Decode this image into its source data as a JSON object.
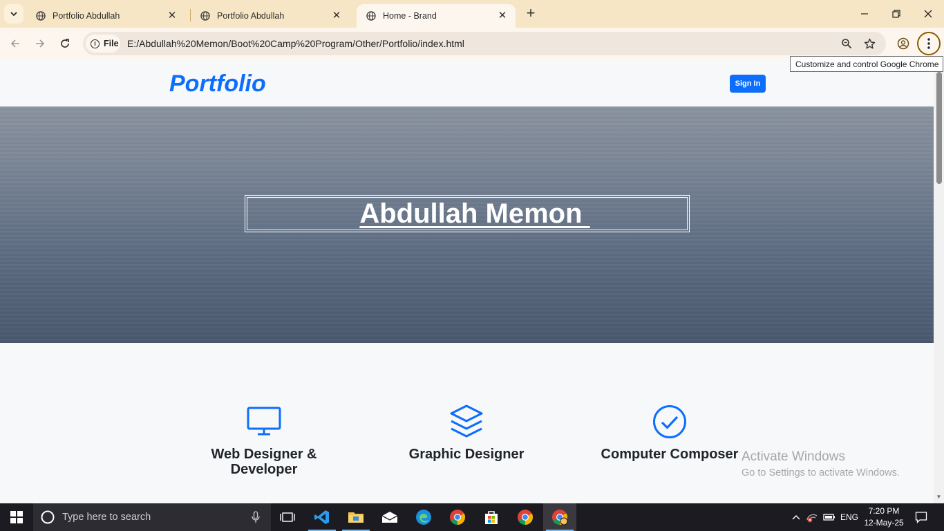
{
  "browser": {
    "tabs": [
      {
        "title": "Portfolio Abdullah",
        "active": false
      },
      {
        "title": "Portfolio Abdullah",
        "active": false
      },
      {
        "title": "Home - Brand",
        "active": true
      }
    ],
    "new_tab_label": "+",
    "chip_label": "File",
    "url": "E:/Abdullah%20Memon/Boot%20Camp%20Program/Other/Portfolio/index.html",
    "tooltip": "Customize and control Google Chrome"
  },
  "page": {
    "brand": "Portfolio",
    "signin_label": "Sign In",
    "hero_title": "Abdullah Memon ",
    "features": [
      {
        "icon": "monitor-icon",
        "title_line1": "Web Designer &",
        "title_line2": "Developer"
      },
      {
        "icon": "layers-icon",
        "title_line1": "Graphic Designer",
        "title_line2": ""
      },
      {
        "icon": "check-circle-icon",
        "title_line1": "Computer Composer",
        "title_line2": ""
      }
    ],
    "accent_color": "#0d6efd"
  },
  "watermark": {
    "line1": "Activate Windows",
    "line2": "Go to Settings to activate Windows."
  },
  "taskbar": {
    "search_placeholder": "Type here to search",
    "language": "ENG",
    "time": "7:20 PM",
    "date": "12-May-25"
  }
}
